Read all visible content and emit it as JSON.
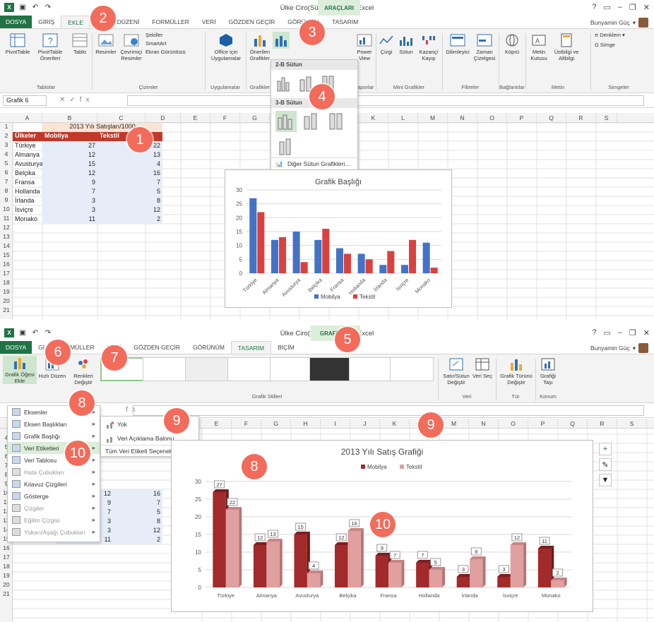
{
  "p1": {
    "window_title": "Ülke Ciro(Sütun Grafiği) - Excel",
    "context_tab_label": "ARAÇLARI",
    "tabs": [
      "DOSYA",
      "GİRİŞ",
      "EKLE",
      "SAYFA DÜZENİ",
      "FORMÜLLER",
      "VERİ",
      "GÖZDEN GEÇİR",
      "GÖRÜNÜM",
      "TASARIM"
    ],
    "active_tab": "EKLE",
    "user": "Bunyamin Güç",
    "ribbon": {
      "groups": [
        "Tablolar",
        "Çizimler",
        "Uygulamalar",
        "Grafikler",
        "Raporlar",
        "Mini Grafikler",
        "Filtreler",
        "Bağlantılar",
        "Metin",
        "Simgeler"
      ],
      "buttons": [
        "PivotTable",
        "PivotTable Önerileri",
        "Tablo",
        "Resimler",
        "Çevrimiçi Resimler",
        "Şekiller",
        "SmartArt",
        "Ekran Görüntüsü",
        "Office için Uygulamalar",
        "Önerilen Grafikler",
        "Power View",
        "Çizgi",
        "Sütun",
        "Kazanç/ Kayıp",
        "Dilimleyici",
        "Zaman Çizelgesi",
        "Köprü",
        "Metin Kutusu",
        "Üstbilgi ve Altbilgi",
        "Denklem",
        "Simge"
      ]
    },
    "name_box": "Grafik 6",
    "fx_label": "fx",
    "columns": [
      "A",
      "B",
      "C",
      "D",
      "E",
      "F",
      "G",
      "H",
      "I",
      "J",
      "K",
      "L",
      "M",
      "N",
      "O",
      "P",
      "Q",
      "R",
      "S"
    ],
    "rows": [
      "1",
      "2",
      "3",
      "4",
      "5",
      "6",
      "7",
      "8",
      "9",
      "10",
      "11",
      "12",
      "13",
      "14",
      "15",
      "16",
      "17",
      "18",
      "19",
      "20",
      "21"
    ],
    "table_title": "2013 Yılı Satışları/1000",
    "headers": [
      "Ülkeler",
      "Mobilya",
      "Tekstil"
    ],
    "data": [
      [
        "Türkiye",
        "27",
        "22"
      ],
      [
        "Almanya",
        "12",
        "13"
      ],
      [
        "Avusturya",
        "15",
        "4"
      ],
      [
        "Belçika",
        "12",
        "16"
      ],
      [
        "Fransa",
        "9",
        "7"
      ],
      [
        "Hollanda",
        "7",
        "5"
      ],
      [
        "İrlanda",
        "3",
        "8"
      ],
      [
        "İsviçre",
        "3",
        "12"
      ],
      [
        "Monako",
        "11",
        "2"
      ]
    ],
    "dropdown": {
      "section1": "2-B Sütun",
      "section2": "3-B Sütun",
      "footer": "Diğer Sütun Grafikleri..."
    },
    "chart": {
      "title": "Grafik Başlığı",
      "legend": [
        "Mobilya",
        "Tekstil"
      ],
      "y_ticks": [
        "0",
        "5",
        "10",
        "15",
        "20",
        "25",
        "30"
      ]
    },
    "callouts": [
      "1",
      "2",
      "3",
      "4"
    ]
  },
  "p2": {
    "window_title": "Ülke Ciro(Sütun Grafiği) - Excel",
    "context_tab_label": "GRAFİK AR",
    "tabs": [
      "DOSYA",
      "Gİ",
      "FORMÜLLER",
      "VERİ",
      "GÖZDEN GEÇİR",
      "GÖRÜNÜM",
      "TASARIM",
      "BİÇİM"
    ],
    "active_tab": "TASARIM",
    "user": "Bunyamin Güç",
    "ribbon": {
      "buttons": [
        "Grafik Öğesi Ekle",
        "Hızlı Düzen",
        "Renkleri Değiştir",
        "Satır/Sütun Değiştir",
        "Veri Seç",
        "Grafik Türünü Değiştir",
        "Grafiği Taşı"
      ],
      "groups": [
        "Grafik Stilleri",
        "Veri",
        "Tür",
        "Konum"
      ]
    },
    "fx_label": "fx",
    "menu": [
      {
        "label": "Eksenler",
        "dim": false
      },
      {
        "label": "Eksen Başlıkları",
        "dim": false
      },
      {
        "label": "Grafik Başlığı",
        "dim": false
      },
      {
        "label": "Veri Etiketleri",
        "dim": false
      },
      {
        "label": "Veri Tablosu",
        "dim": false
      },
      {
        "label": "Hata Çubukları",
        "dim": true
      },
      {
        "label": "Kılavuz Çizgileri",
        "dim": false
      },
      {
        "label": "Gösterge",
        "dim": false
      },
      {
        "label": "Çizgiler",
        "dim": true
      },
      {
        "label": "Eğilim Çizgisi",
        "dim": true
      },
      {
        "label": "Yukarı/Aşağı Çubukları",
        "dim": true
      }
    ],
    "submenu": [
      "Yok",
      "Veri Açıklama Balonu",
      "Tüm Veri Etiketi Seçenekleri..."
    ],
    "rows": [
      "10",
      "11",
      "12",
      "13",
      "14",
      "15",
      "16",
      "17",
      "18",
      "19",
      "20",
      "21"
    ],
    "partial_rows": [
      [
        "",
        "12",
        "16"
      ],
      [
        "",
        "9",
        "7"
      ],
      [
        "",
        "7",
        "5"
      ],
      [
        "",
        "3",
        "8"
      ],
      [
        "İsviçre",
        "3",
        "12"
      ],
      [
        "Monako",
        "11",
        "2"
      ]
    ],
    "columns": [
      "E",
      "F",
      "G",
      "H",
      "I",
      "J",
      "K",
      "L",
      "M",
      "N",
      "O",
      "P",
      "Q",
      "R",
      "S"
    ],
    "chart": {
      "title": "2013 Yılı Satış Grafiği",
      "legend": [
        "Mobilya",
        "Tekstil"
      ],
      "y_ticks": [
        "0",
        "5",
        "10",
        "15",
        "20",
        "25",
        "30"
      ]
    },
    "side_buttons": [
      "+",
      "✎",
      "▼"
    ],
    "callouts": [
      "5",
      "6",
      "7",
      "8",
      "9",
      "10",
      "8",
      "9",
      "10"
    ]
  },
  "chart_data": [
    {
      "type": "bar",
      "title": "Grafik Başlığı",
      "categories": [
        "Türkiye",
        "Almanya",
        "Avusturya",
        "Belçika",
        "Fransa",
        "Hollanda",
        "İrlanda",
        "İsviçre",
        "Monako"
      ],
      "series": [
        {
          "name": "Mobilya",
          "values": [
            27,
            12,
            15,
            12,
            9,
            7,
            3,
            3,
            11
          ]
        },
        {
          "name": "Tekstil",
          "values": [
            22,
            13,
            4,
            16,
            7,
            5,
            8,
            12,
            2
          ]
        }
      ],
      "ylim": [
        0,
        30
      ],
      "colors": [
        "#4472c4",
        "#d9413f"
      ],
      "grid": true,
      "legend": "bottom"
    },
    {
      "type": "bar",
      "title": "2013 Yılı Satış Grafiği",
      "categories": [
        "Türkiye",
        "Almanya",
        "Avusturya",
        "Belçika",
        "Fransa",
        "Hollanda",
        "İrlanda",
        "İsviçre",
        "Monako"
      ],
      "series": [
        {
          "name": "Mobilya",
          "values": [
            27,
            12,
            15,
            12,
            9,
            7,
            3,
            3,
            11
          ]
        },
        {
          "name": "Tekstil",
          "values": [
            22,
            13,
            4,
            16,
            7,
            5,
            8,
            12,
            2
          ]
        }
      ],
      "ylim": [
        0,
        30
      ],
      "colors": [
        "#a32a2a",
        "#e0a0a0"
      ],
      "grid": true,
      "legend": "top",
      "data_labels": true
    }
  ]
}
